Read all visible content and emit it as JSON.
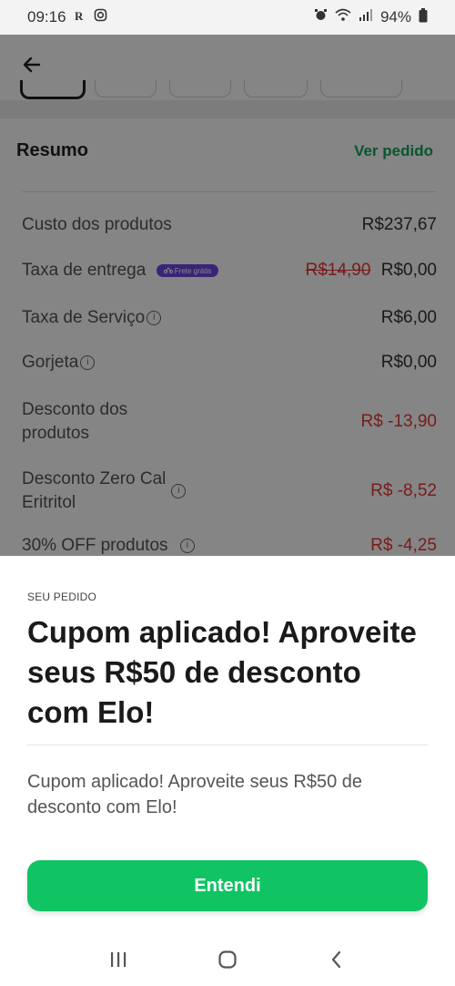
{
  "status_bar": {
    "time": "09:16",
    "battery": "94%"
  },
  "summary": {
    "title": "Resumo",
    "view_order": "Ver pedido",
    "rows": [
      {
        "label": "Custo dos produtos",
        "value": "R$237,67"
      },
      {
        "label": "Taxa de entrega",
        "badge": "Frete grátis",
        "old_value": "R$14,90",
        "value": "R$0,00"
      },
      {
        "label": "Taxa de Serviço",
        "value": "R$6,00"
      },
      {
        "label": "Gorjeta",
        "value": "R$0,00"
      },
      {
        "label_line1": "Desconto dos",
        "label_line2": "produtos",
        "value": "R$ -13,90"
      },
      {
        "label_line1": "Desconto Zero Cal",
        "label_line2": "Eritritol",
        "value": "R$ -8,52"
      },
      {
        "label": "30% OFF produtos",
        "value": "R$ -4,25"
      }
    ]
  },
  "sheet": {
    "label": "SEU PEDIDO",
    "title": "Cupom aplicado! Aproveite seus R$50 de desconto com Elo!",
    "description": "Cupom aplicado! Aproveite seus R$50 de desconto com Elo!",
    "button": "Entendi"
  },
  "colors": {
    "brand_green": "#11c463",
    "link_green": "#11a65a",
    "discount_red": "#e53935",
    "badge_purple": "#6d47e6"
  }
}
